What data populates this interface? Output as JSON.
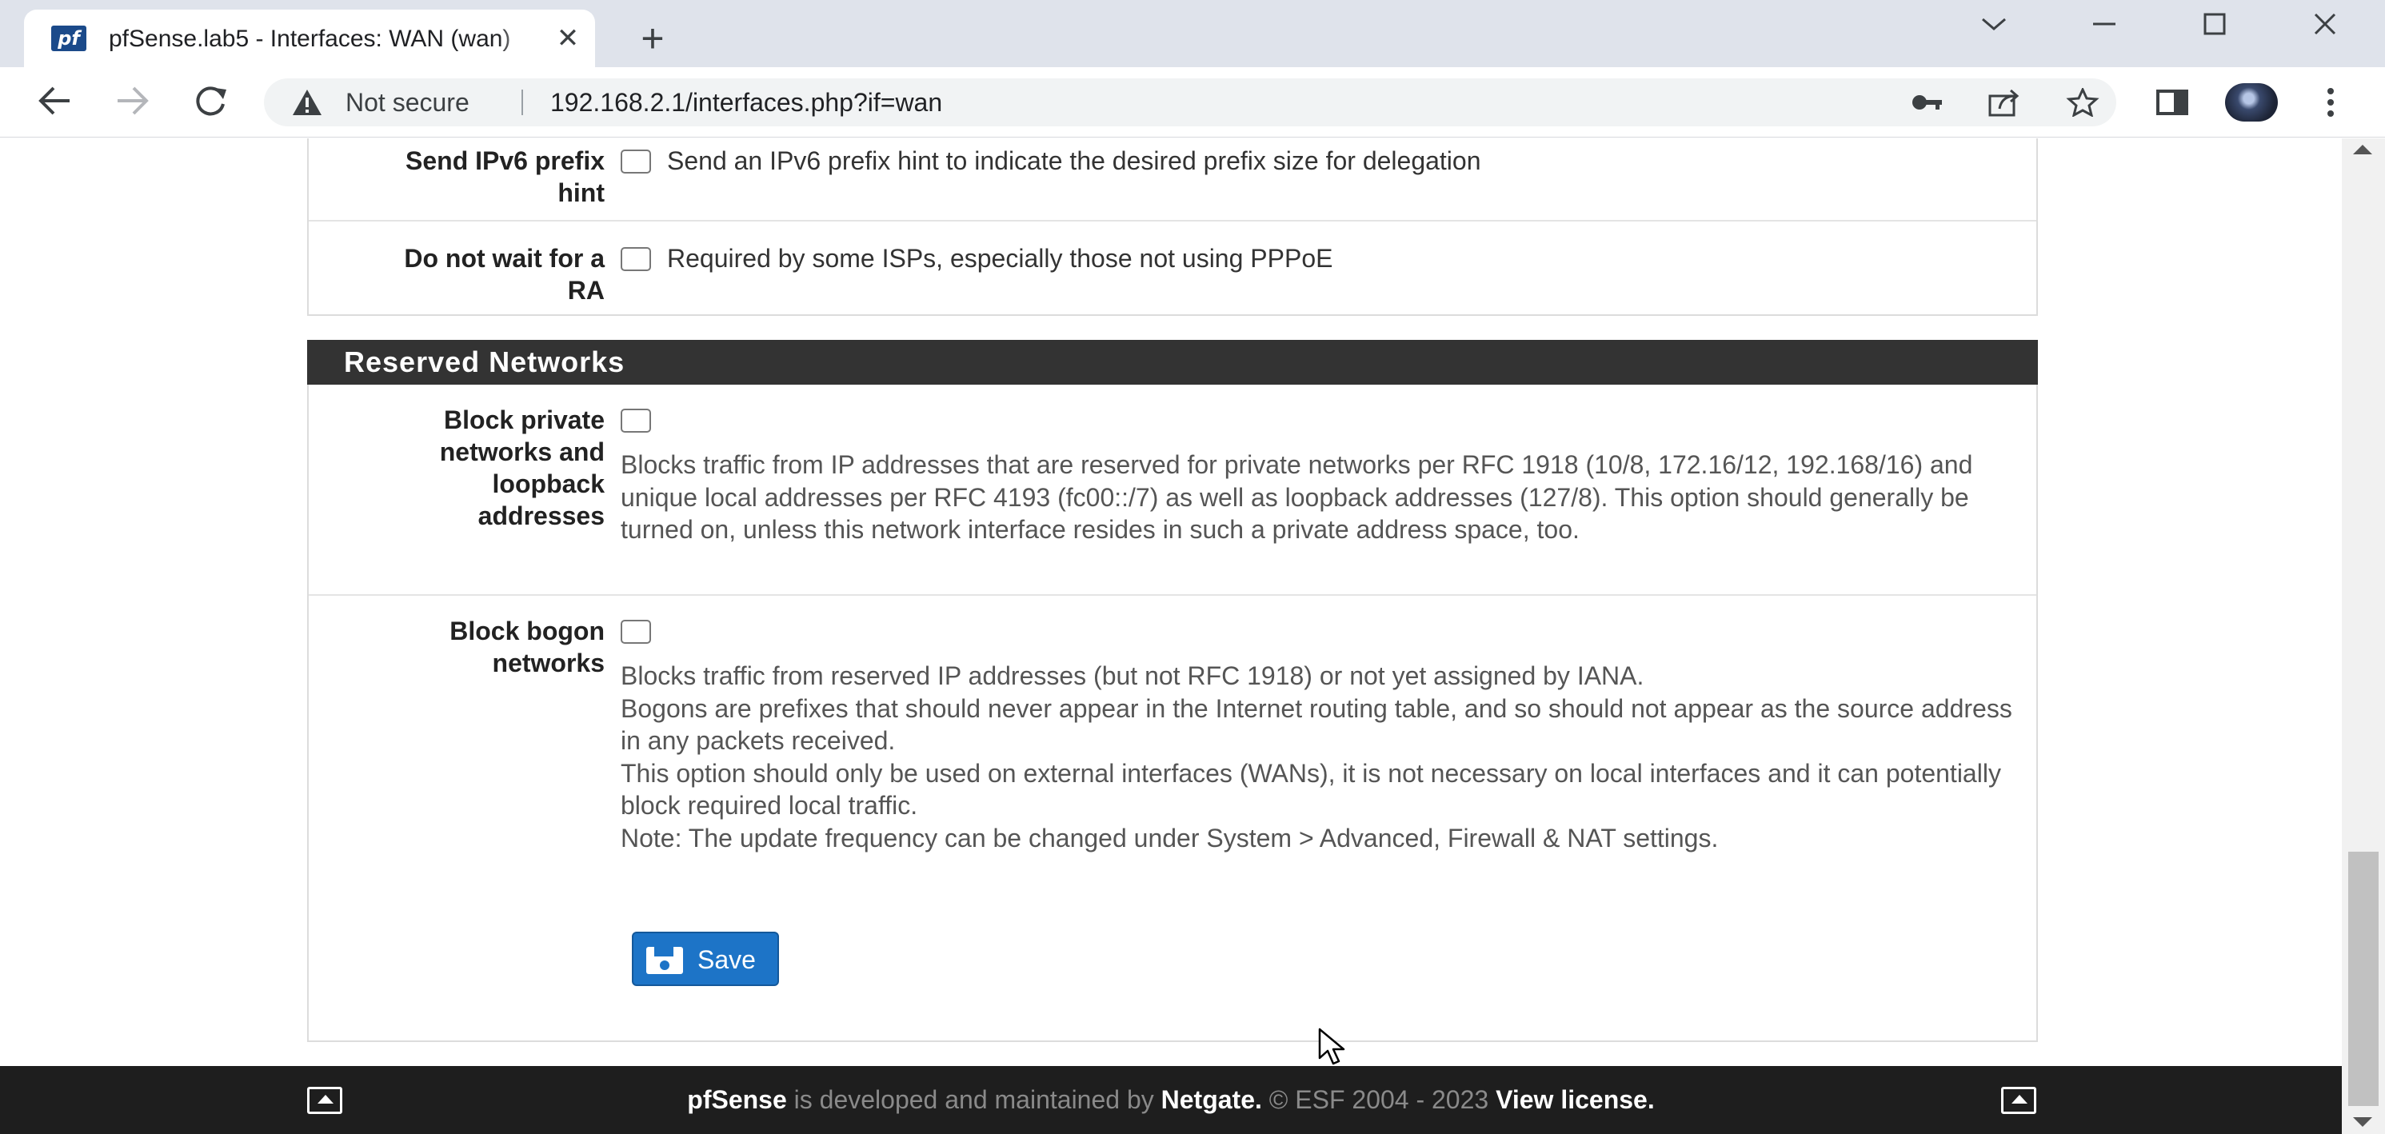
{
  "browser": {
    "tab_title": "pfSense.lab5 - Interfaces: WAN (wan)",
    "tab_close": "✕",
    "new_tab": "+",
    "security_label": "Not secure",
    "url": "192.168.2.1/interfaces.php?if=wan"
  },
  "dhcp6_options": [
    {
      "label": "Send IPv6 prefix hint",
      "text": "Send an IPv6 prefix hint to indicate the desired prefix size for delegation",
      "checked": false
    },
    {
      "label": "Do not wait for a RA",
      "text": "Required by some ISPs, especially those not using PPPoE",
      "checked": false
    }
  ],
  "reserved_networks": {
    "heading": "Reserved Networks",
    "block_private": {
      "label": "Block private networks and loopback addresses",
      "checked": false,
      "help": "Blocks traffic from IP addresses that are reserved for private networks per RFC 1918 (10/8, 172.16/12, 192.168/16) and unique local addresses per RFC 4193 (fc00::/7) as well as loopback addresses (127/8). This option should generally be turned on, unless this network interface resides in such a private address space, too."
    },
    "block_bogon": {
      "label": "Block bogon networks",
      "checked": false,
      "help_lines": [
        "Blocks traffic from reserved IP addresses (but not RFC 1918) or not yet assigned by IANA.",
        "Bogons are prefixes that should never appear in the Internet routing table, and so should not appear as the source address in any packets received.",
        "This option should only be used on external interfaces (WANs), it is not necessary on local interfaces and it can potentially block required local traffic.",
        "Note: The update frequency can be changed under System > Advanced, Firewall & NAT settings."
      ]
    }
  },
  "save_label": "Save",
  "footer": {
    "brand": "pfSense",
    "middle": " is developed and maintained by ",
    "company": "Netgate.",
    "copyright": " © ESF 2004 - 2023 ",
    "license": "View license."
  },
  "icons": {
    "tab_favicon": "pf",
    "security": "warning-triangle-icon",
    "password": "key-icon",
    "share": "share-icon",
    "bookmark": "star-icon",
    "sidebar": "side-panel-icon",
    "menu": "kebab-menu-icon",
    "save": "floppy-disk-icon",
    "footer_toggle": "eject-icon"
  },
  "colors": {
    "section_header": "#333333",
    "save_button": "#1d74c7",
    "footer_bg": "#1e1e1e"
  }
}
